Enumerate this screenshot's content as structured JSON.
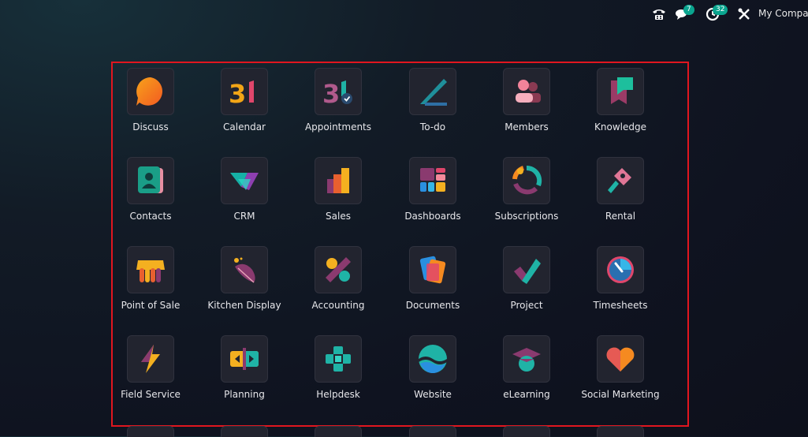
{
  "topbar": {
    "phone_icon": "phone-icon",
    "chat_icon": "chat-icon",
    "chat_count": "7",
    "activity_icon": "clock-icon",
    "activity_count": "32",
    "settings_icon": "tools-icon",
    "company": "My Company"
  },
  "apps": [
    {
      "label": "Discuss",
      "icon": "discuss-icon"
    },
    {
      "label": "Calendar",
      "icon": "calendar-icon"
    },
    {
      "label": "Appointments",
      "icon": "appointments-icon"
    },
    {
      "label": "To-do",
      "icon": "todo-icon"
    },
    {
      "label": "Members",
      "icon": "members-icon"
    },
    {
      "label": "Knowledge",
      "icon": "knowledge-icon"
    },
    {
      "label": "Contacts",
      "icon": "contacts-icon"
    },
    {
      "label": "CRM",
      "icon": "crm-icon"
    },
    {
      "label": "Sales",
      "icon": "sales-icon"
    },
    {
      "label": "Dashboards",
      "icon": "dashboards-icon"
    },
    {
      "label": "Subscriptions",
      "icon": "subscriptions-icon"
    },
    {
      "label": "Rental",
      "icon": "rental-icon"
    },
    {
      "label": "Point of Sale",
      "icon": "point-of-sale-icon"
    },
    {
      "label": "Kitchen Display",
      "icon": "kitchen-display-icon"
    },
    {
      "label": "Accounting",
      "icon": "accounting-icon"
    },
    {
      "label": "Documents",
      "icon": "documents-icon"
    },
    {
      "label": "Project",
      "icon": "project-icon"
    },
    {
      "label": "Timesheets",
      "icon": "timesheets-icon"
    },
    {
      "label": "Field Service",
      "icon": "field-service-icon"
    },
    {
      "label": "Planning",
      "icon": "planning-icon"
    },
    {
      "label": "Helpdesk",
      "icon": "helpdesk-icon"
    },
    {
      "label": "Website",
      "icon": "website-icon"
    },
    {
      "label": "eLearning",
      "icon": "elearning-icon"
    },
    {
      "label": "Social Marketing",
      "icon": "social-marketing-icon"
    }
  ],
  "colors": {
    "highlight_border": "#e0161f",
    "badge": "#0aa58f",
    "tile": "#22242f"
  }
}
